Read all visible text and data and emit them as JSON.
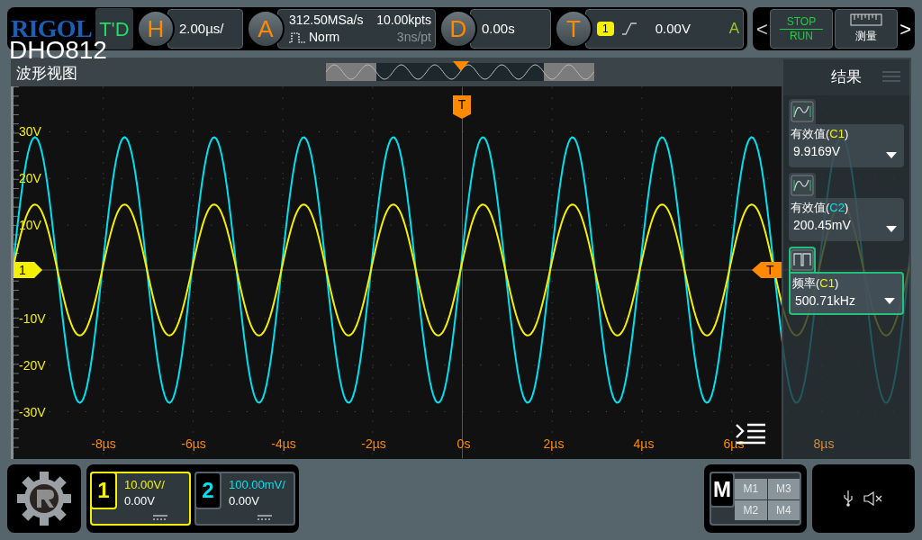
{
  "top_bar": {
    "logo": "RIGOL",
    "model": "DHO812",
    "mode_button": "T'D",
    "horizontal": {
      "letter": "H",
      "scale": "2.00µs/"
    },
    "acquire": {
      "letter": "A",
      "sample_rate": "312.50MSa/s",
      "memory_depth": "10.00kpts",
      "mode": "Norm",
      "resolution": "3ns/pt"
    },
    "delay": {
      "letter": "D",
      "value": "0.00s"
    },
    "trigger": {
      "letter": "T",
      "source": "1",
      "level": "0.00V",
      "sweep": "A"
    },
    "prev": "<",
    "run_button": {
      "top": "STOP",
      "bottom": "RUN"
    },
    "measure_button": "测量",
    "next": ">"
  },
  "waveform_view": {
    "title": "波形视图",
    "trigger_marker": "T",
    "level_marker": "T",
    "channel_marker": "1",
    "y_labels": [
      "30V",
      "20V",
      "10V",
      "-10V",
      "-20V",
      "-30V"
    ],
    "x_labels": [
      "-8µs",
      "-6µs",
      "-4µs",
      "-2µs",
      "0s",
      "2µs",
      "4µs",
      "6µs",
      "8µs"
    ]
  },
  "results": {
    "title": "结果",
    "items": [
      {
        "name": "有效值(",
        "channel": "C1",
        "close": ")",
        "value": "9.9169V",
        "selected": false,
        "color": "#f5f000"
      },
      {
        "name": "有效值(",
        "channel": "C2",
        "close": ")",
        "value": "200.45mV",
        "selected": false,
        "color": "#00e1f0"
      },
      {
        "name": "频率(",
        "channel": "C1",
        "close": ")",
        "value": "500.71kHz",
        "selected": true,
        "color": "#f5f000"
      }
    ]
  },
  "channels": [
    {
      "number": "1",
      "scale": "10.00V/",
      "offset": "0.00V",
      "selected": true,
      "color": "#f5f000"
    },
    {
      "number": "2",
      "scale": "100.00mV/",
      "offset": "0.00V",
      "selected": false,
      "color": "#00e1f0"
    }
  ],
  "math": {
    "letter": "M",
    "buttons": [
      "M1",
      "M3",
      "M2",
      "M4"
    ]
  }
}
